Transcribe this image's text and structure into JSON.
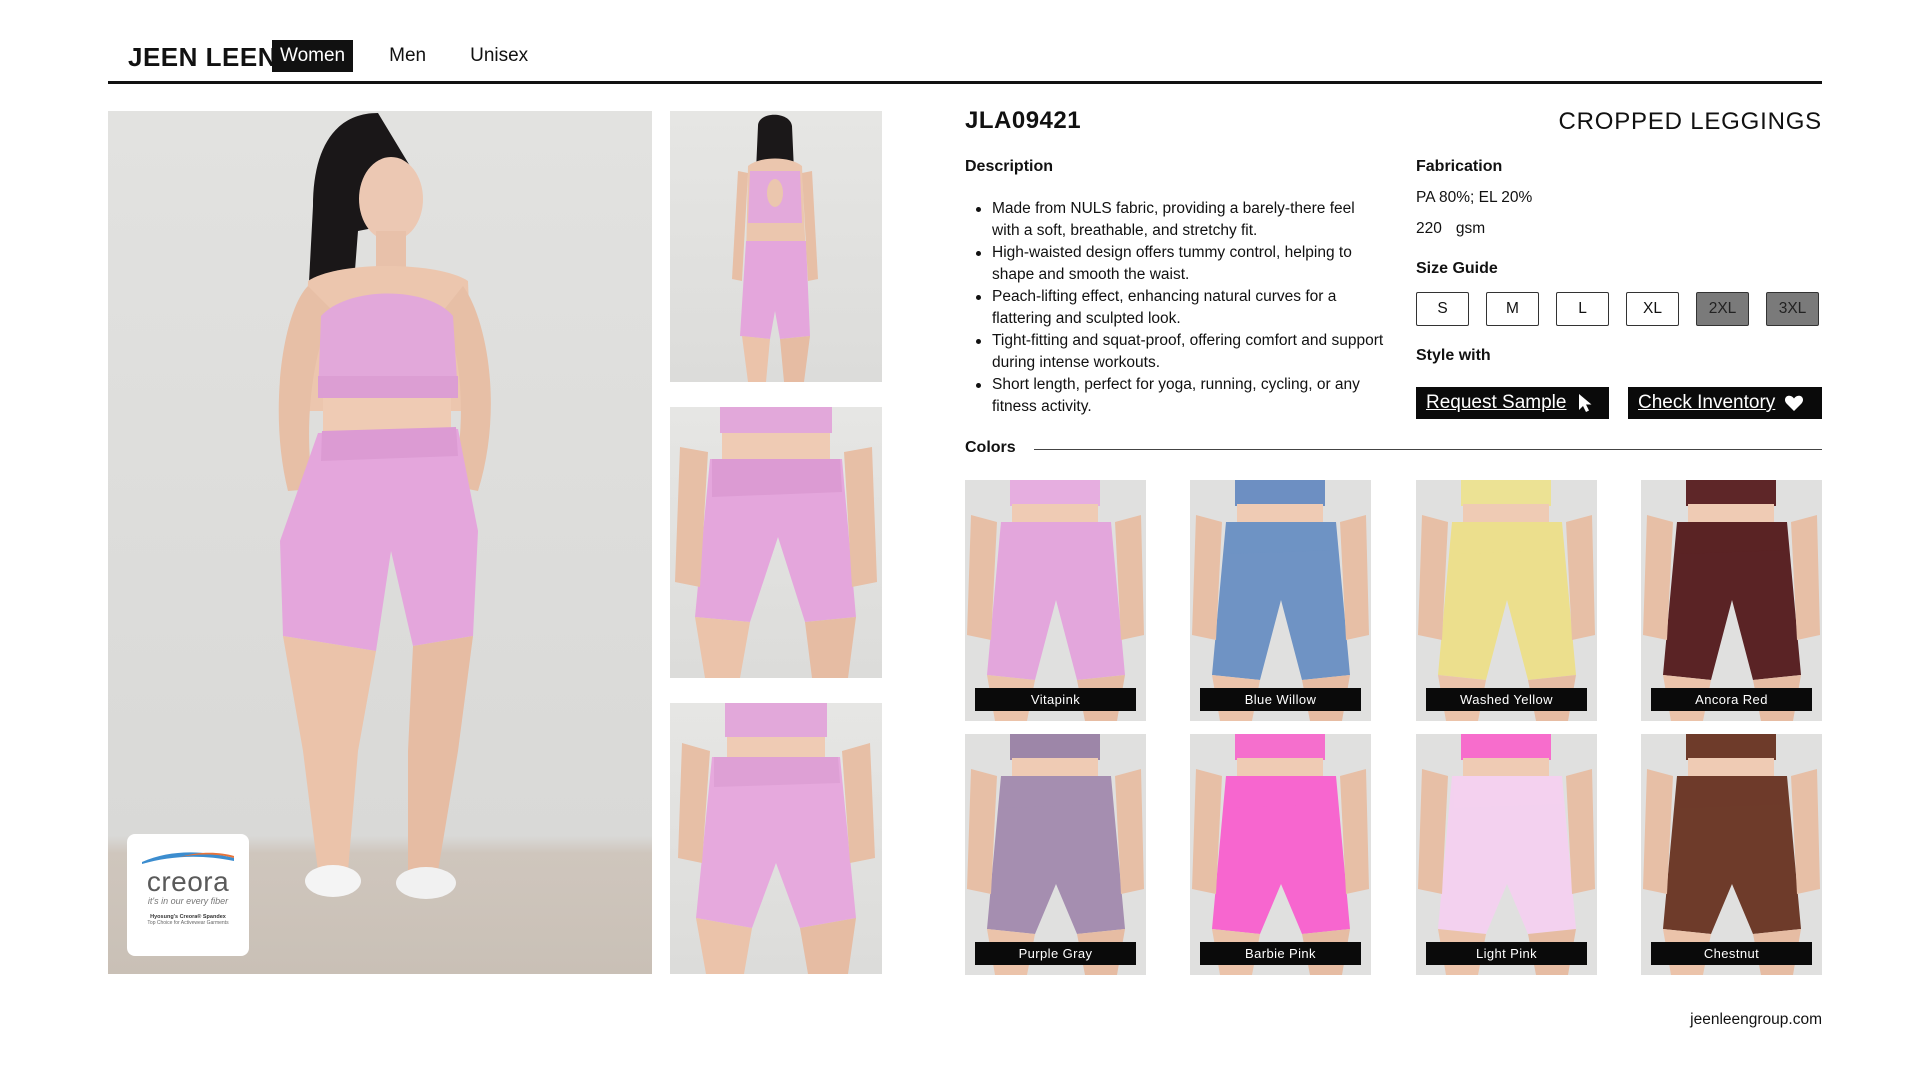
{
  "header": {
    "brand": "JEEN LEEN",
    "nav": [
      {
        "label": "Women",
        "active": true
      },
      {
        "label": "Men",
        "active": false
      },
      {
        "label": "Unisex",
        "active": false
      }
    ]
  },
  "gallery": {
    "main_photo_icon": "model-front-photo",
    "thumbnails": [
      "model-back-photo",
      "leggings-front-closeup-photo",
      "leggings-back-closeup-photo"
    ],
    "badge": {
      "name": "creora",
      "tagline": "it's in our every fiber",
      "line1": "Hyosung's Creora® Spandex",
      "line2": "Top Choice for Activewear Garments"
    }
  },
  "product": {
    "sku": "JLA09421",
    "name": "CROPPED LEGGINGS",
    "description_title": "Description",
    "description": [
      "Made from NULS fabric, providing a barely-there feel with a soft, breathable, and stretchy fit.",
      "High-waisted design offers tummy control, helping to shape and smooth the waist.",
      "Peach-lifting effect, enhancing natural curves for a flattering and sculpted look.",
      "Tight-fitting and squat-proof, offering comfort and support during intense workouts.",
      "Short length, perfect for yoga, running, cycling, or any fitness activity."
    ],
    "fabrication_title": "Fabrication",
    "composition": "PA 80%; EL 20%",
    "weight_value": "220",
    "weight_unit": "gsm",
    "size_title": "Size Guide",
    "sizes": [
      {
        "label": "S",
        "available": true
      },
      {
        "label": "M",
        "available": true
      },
      {
        "label": "L",
        "available": true
      },
      {
        "label": "XL",
        "available": true
      },
      {
        "label": "2XL",
        "available": false
      },
      {
        "label": "3XL",
        "available": false
      }
    ],
    "style_title": "Style with",
    "request_sample_label": "Request Sample",
    "check_inventory_label": "Check Inventory",
    "colors_title": "Colors",
    "colors": [
      {
        "name": "Vitapink",
        "hex": "#e3a6dc",
        "top": "#e6aee0"
      },
      {
        "name": "Blue Willow",
        "hex": "#6f93c4",
        "top": "#6d8fc2"
      },
      {
        "name": "Washed Yellow",
        "hex": "#ecdf8d",
        "top": "#ece294"
      },
      {
        "name": "Ancora Red",
        "hex": "#5a2325",
        "top": "#5e2628"
      },
      {
        "name": "Purple Gray",
        "hex": "#a58eb0",
        "top": "#9d86a8"
      },
      {
        "name": "Barbie Pink",
        "hex": "#f766cf",
        "top": "#f56fcd"
      },
      {
        "name": "Light Pink",
        "hex": "#f3d1ef",
        "top": "#f76dcc"
      },
      {
        "name": "Chestnut",
        "hex": "#6e3b2a",
        "top": "#6e3b2a"
      }
    ]
  },
  "footer": {
    "url": "jeenleengroup.com"
  },
  "accent_colors": {
    "primary": "#0a0a0a",
    "product_pink": "#e3a6dc",
    "unavailable_size": "#7a7a7a"
  }
}
